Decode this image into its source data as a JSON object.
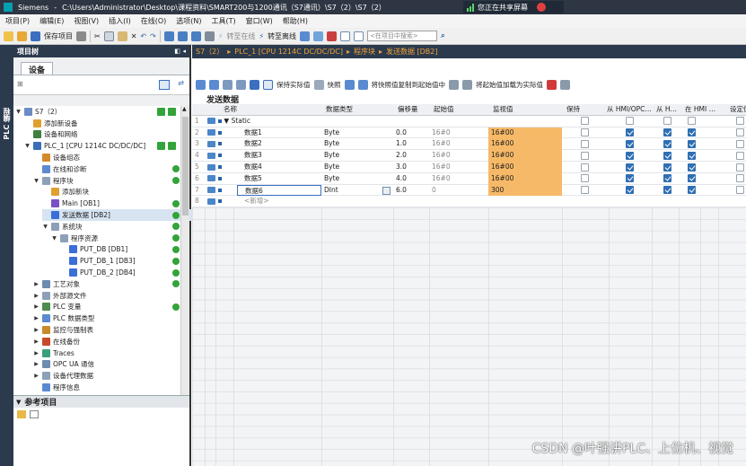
{
  "window": {
    "app": "Siemens",
    "path": "C:\\Users\\Administrator\\Desktop\\课程资料\\SMART200与1200通讯（S7通讯）\\S7（2）\\S7（2）",
    "share_label": "您正在共享屏幕"
  },
  "menu": [
    "项目(P)",
    "编辑(E)",
    "视图(V)",
    "插入(I)",
    "在线(O)",
    "选项(N)",
    "工具(T)",
    "窗口(W)",
    "帮助(H)"
  ],
  "toolbar": {
    "save": "保存项目",
    "go_online": "转至在线",
    "go_offline": "转至离线",
    "search_placeholder": "<在项目中搜索>"
  },
  "side_strip": "PLC 编程",
  "project_tree": {
    "title": "项目树",
    "devices_tab": "设备",
    "items": [
      {
        "label": "S7（2）",
        "level": 0,
        "arrow": "▼",
        "icon": "#6b8cc6",
        "status": "ok"
      },
      {
        "label": "添加新设备",
        "level": 1,
        "arrow": "",
        "icon": "#e0a030"
      },
      {
        "label": "设备和网络",
        "level": 1,
        "arrow": "",
        "icon": "#3f7f3f"
      },
      {
        "label": "PLC_1 [CPU 1214C DC/DC/DC]",
        "level": 1,
        "arrow": "▼",
        "icon": "#3a6fb8",
        "status": "ok"
      },
      {
        "label": "设备组态",
        "level": 2,
        "arrow": "",
        "icon": "#d48a2a"
      },
      {
        "label": "在线和诊断",
        "level": 2,
        "arrow": "",
        "icon": "#5a8ad0",
        "dot": true
      },
      {
        "label": "程序块",
        "level": 2,
        "arrow": "▼",
        "icon": "#8da0b8",
        "dot": true
      },
      {
        "label": "添加新块",
        "level": 3,
        "arrow": "",
        "icon": "#e0a030"
      },
      {
        "label": "Main [OB1]",
        "level": 3,
        "arrow": "",
        "icon": "#7b4fc7",
        "dot": true
      },
      {
        "label": "发送数据 [DB2]",
        "level": 3,
        "arrow": "",
        "icon": "#3a6fd8",
        "dot": true,
        "selected": true
      },
      {
        "label": "系统块",
        "level": 3,
        "arrow": "▼",
        "icon": "#8da0b8",
        "dot": true
      },
      {
        "label": "程序资源",
        "level": 4,
        "arrow": "▼",
        "icon": "#8da0b8",
        "dot": true
      },
      {
        "label": "PUT_DB [DB1]",
        "level": 5,
        "arrow": "",
        "icon": "#3a6fd8",
        "dot": true
      },
      {
        "label": "PUT_DB_1 [DB3]",
        "level": 5,
        "arrow": "",
        "icon": "#3a6fd8",
        "dot": true
      },
      {
        "label": "PUT_DB_2 [DB4]",
        "level": 5,
        "arrow": "",
        "icon": "#3a6fd8",
        "dot": true
      },
      {
        "label": "工艺对象",
        "level": 2,
        "arrow": "▶",
        "icon": "#6c8cb0",
        "dot": true
      },
      {
        "label": "外部源文件",
        "level": 2,
        "arrow": "▶",
        "icon": "#8da0b8"
      },
      {
        "label": "PLC 变量",
        "level": 2,
        "arrow": "▶",
        "icon": "#4e8d4e",
        "dot": true
      },
      {
        "label": "PLC 数据类型",
        "level": 2,
        "arrow": "▶",
        "icon": "#5a8ad0"
      },
      {
        "label": "监控与强制表",
        "level": 2,
        "arrow": "▶",
        "icon": "#c88a2a"
      },
      {
        "label": "在线备份",
        "level": 2,
        "arrow": "▶",
        "icon": "#c84a2a"
      },
      {
        "label": "Traces",
        "level": 2,
        "arrow": "▶",
        "icon": "#3a9f7a"
      },
      {
        "label": "OPC UA 通信",
        "level": 2,
        "arrow": "▶",
        "icon": "#6c8cb0"
      },
      {
        "label": "设备代理数据",
        "level": 2,
        "arrow": "▶",
        "icon": "#8da0b8"
      },
      {
        "label": "程序信息",
        "level": 2,
        "arrow": "",
        "icon": "#5a8ad0"
      }
    ],
    "reference_title": "参考项目"
  },
  "editor": {
    "breadcrumb": [
      "S7（2）",
      "PLC_1 [CPU 1214C DC/DC/DC]",
      "程序块",
      "发送数据 [DB2]"
    ],
    "tools": {
      "keep_actual": "保持实际值",
      "snapshot": "快照",
      "copy_snapshot": "将快照值复制到起始值中",
      "load_start": "将起始值加载为实际值"
    },
    "db_title": "发送数据",
    "columns": [
      "名称",
      "数据类型",
      "偏移量",
      "起始值",
      "监视值",
      "保持",
      "从 HMI/OPC…",
      "从 H…",
      "在 HMI …",
      "设定值"
    ],
    "static_label": "Static",
    "rows": [
      {
        "no": "1",
        "name": "Static",
        "type": "",
        "offset": "",
        "start": "",
        "monitor": "",
        "static": true
      },
      {
        "no": "2",
        "name": "数据1",
        "type": "Byte",
        "offset": "0.0",
        "start": "16#0",
        "monitor": "16#00"
      },
      {
        "no": "3",
        "name": "数据2",
        "type": "Byte",
        "offset": "1.0",
        "start": "16#0",
        "monitor": "16#00"
      },
      {
        "no": "4",
        "name": "数据3",
        "type": "Byte",
        "offset": "2.0",
        "start": "16#0",
        "monitor": "16#00"
      },
      {
        "no": "5",
        "name": "数据4",
        "type": "Byte",
        "offset": "3.0",
        "start": "16#0",
        "monitor": "16#00"
      },
      {
        "no": "6",
        "name": "数据5",
        "type": "Byte",
        "offset": "4.0",
        "start": "16#0",
        "monitor": "16#00"
      },
      {
        "no": "7",
        "name": "数据6",
        "type": "DInt",
        "offset": "6.0",
        "start": "0",
        "monitor": "300"
      },
      {
        "no": "8",
        "name": "<新增>",
        "type": "",
        "offset": "",
        "start": "",
        "monitor": "",
        "new": true
      }
    ]
  },
  "watermark": "CSDN @叶强讲PLC、上位机、视觉"
}
